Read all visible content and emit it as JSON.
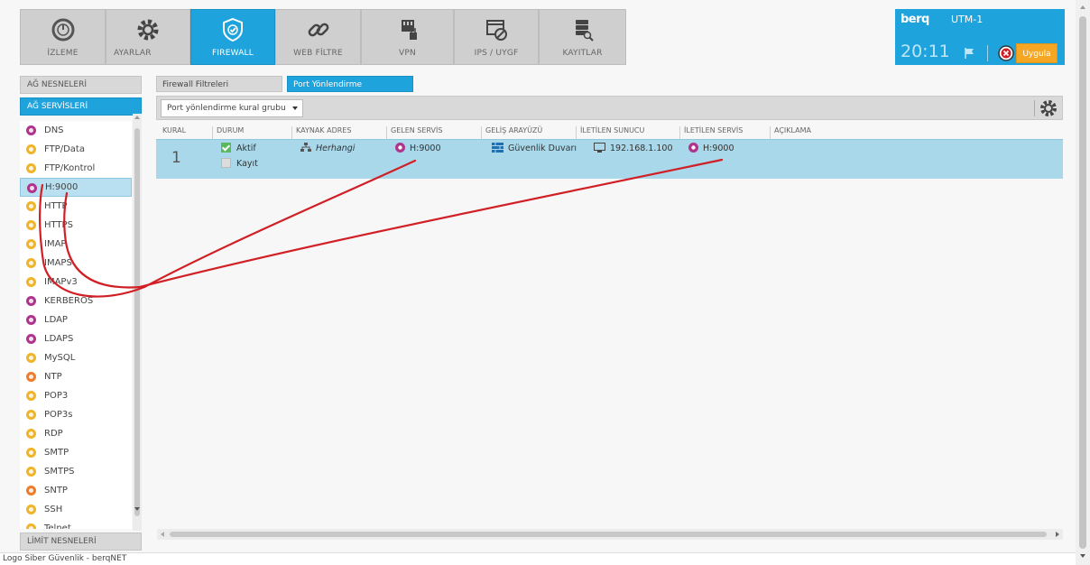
{
  "nav": {
    "items": [
      {
        "label": "İZLEME",
        "icon": "gauge-icon"
      },
      {
        "label": "AYARLAR",
        "icon": "gear-icon"
      },
      {
        "label": "FIREWALL",
        "icon": "shield-icon",
        "active": true
      },
      {
        "label": "WEB FİLTRE",
        "icon": "link-icon"
      },
      {
        "label": "VPN",
        "icon": "vpn-network-icon"
      },
      {
        "label": "IPS / UYGF",
        "icon": "window-block-icon"
      },
      {
        "label": "KAYITLAR",
        "icon": "database-search-icon"
      }
    ]
  },
  "brand": {
    "logo": "berq",
    "device": "UTM-1",
    "time": "20:11",
    "apply_label": "Uygula"
  },
  "left": {
    "header_objects": "AĞ NESNELERİ",
    "header_services": "AĞ SERVİSLERİ",
    "header_limits": "LİMİT NESNELERİ",
    "services": [
      {
        "name": "DNS",
        "color": "#b0338c"
      },
      {
        "name": "FTP/Data",
        "color": "#f0b429"
      },
      {
        "name": "FTP/Kontrol",
        "color": "#f0b429"
      },
      {
        "name": "H:9000",
        "color": "#b0338c",
        "selected": true
      },
      {
        "name": "HTTP",
        "color": "#f0b429"
      },
      {
        "name": "HTTPS",
        "color": "#f0b429"
      },
      {
        "name": "IMAP",
        "color": "#f0b429"
      },
      {
        "name": "IMAPS",
        "color": "#f0b429"
      },
      {
        "name": "IMAPv3",
        "color": "#f0b429"
      },
      {
        "name": "KERBEROS",
        "color": "#b0338c"
      },
      {
        "name": "LDAP",
        "color": "#b0338c"
      },
      {
        "name": "LDAPS",
        "color": "#b0338c"
      },
      {
        "name": "MySQL",
        "color": "#f0b429"
      },
      {
        "name": "NTP",
        "color": "#f07b29"
      },
      {
        "name": "POP3",
        "color": "#f0b429"
      },
      {
        "name": "POP3s",
        "color": "#f0b429"
      },
      {
        "name": "RDP",
        "color": "#f0b429"
      },
      {
        "name": "SMTP",
        "color": "#f0b429"
      },
      {
        "name": "SMTPS",
        "color": "#f0b429"
      },
      {
        "name": "SNTP",
        "color": "#f07b29"
      },
      {
        "name": "SSH",
        "color": "#f0b429"
      },
      {
        "name": "Telnet",
        "color": "#f0b429"
      }
    ]
  },
  "main": {
    "tabs": [
      "Firewall Filtreleri",
      "Port Yönlendirme"
    ],
    "active_tab": "Port Yönlendirme",
    "group_select": "Port yönlendirme kural grubu",
    "columns": [
      "KURAL",
      "DURUM",
      "KAYNAK ADRES",
      "GELEN SERVİS",
      "GELİŞ ARAYÜZÜ",
      "İLETİLEN SUNUCU",
      "İLETİLEN SERVİS",
      "AÇIKLAMA"
    ],
    "row": {
      "rule": "1",
      "status_active": "Aktif",
      "status_log": "Kayıt",
      "source": "Herhangi",
      "incoming_service": "H:9000",
      "interface": "Güvenlik Duvarı",
      "server": "192.168.1.100",
      "forwarded_service": "H:9000",
      "description": ""
    }
  },
  "status_bar": "Logo Siber Güvenlik - berqNET",
  "colors": {
    "accent": "#1fa3dc",
    "apply": "#f5a623",
    "annotation": "#d11f26",
    "selected_row": "#a9d8ea"
  }
}
